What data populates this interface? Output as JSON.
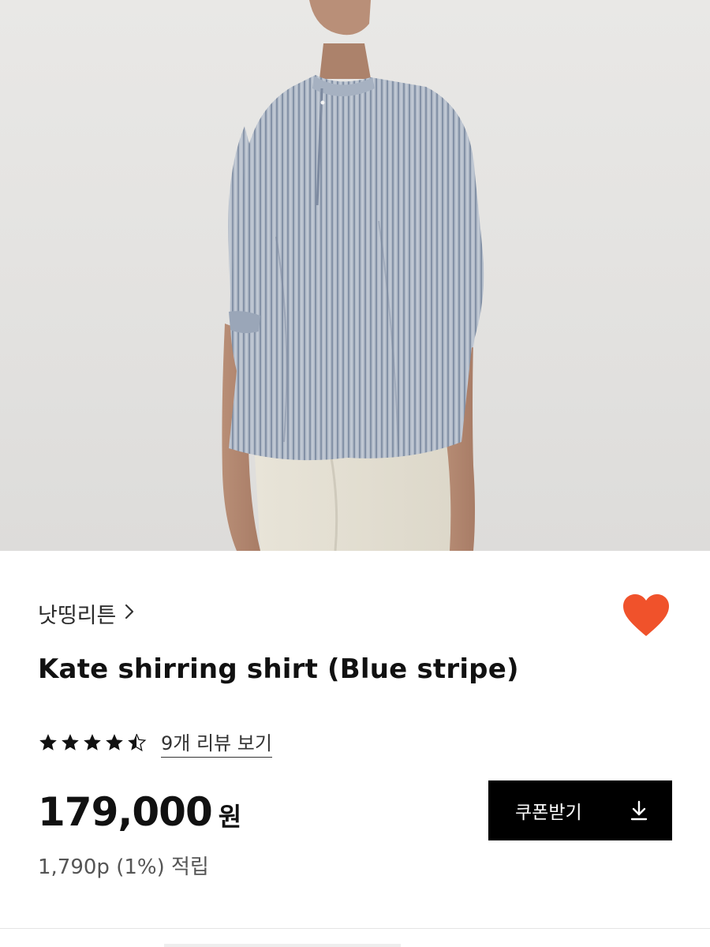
{
  "product": {
    "brand": "낫띵리튼",
    "title": "Kate shirring shirt (Blue stripe)",
    "rating": 4.5,
    "rating_max": 5,
    "review_link": "9개 리뷰 보기",
    "price": "179,000",
    "price_unit": "원",
    "points": "1,790p (1%) 적립"
  },
  "coupon": {
    "label": "쿠폰받기",
    "icon": "download-icon"
  },
  "icons": {
    "brand_arrow": "chevron-right-icon",
    "favorite": "heart-icon",
    "star": "star-icon"
  },
  "colors": {
    "accent": "#f0522b",
    "button_bg": "#000000",
    "text": "#111111",
    "muted": "#555555"
  }
}
